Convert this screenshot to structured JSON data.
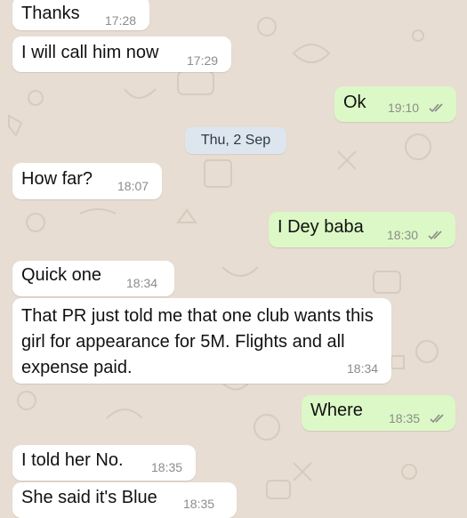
{
  "conversation": {
    "date_separator": "Thu, 2 Sep",
    "messages": [
      {
        "direction": "incoming",
        "text": "Thanks",
        "time": "17:28"
      },
      {
        "direction": "incoming",
        "text": "I will call him now",
        "time": "17:29"
      },
      {
        "direction": "outgoing",
        "text": "Ok",
        "time": "19:10",
        "status": "read"
      },
      {
        "direction": "incoming",
        "text": "How far?",
        "time": "18:07"
      },
      {
        "direction": "outgoing",
        "text": "I Dey baba",
        "time": "18:30",
        "status": "read"
      },
      {
        "direction": "incoming",
        "text": "Quick one",
        "time": "18:34"
      },
      {
        "direction": "incoming",
        "text": "That PR just told me that one club wants this girl for appearance for 5M. Flights and all expense paid.",
        "time": "18:34"
      },
      {
        "direction": "outgoing",
        "text": "Where",
        "time": "18:35",
        "status": "read"
      },
      {
        "direction": "incoming",
        "text": "I told her No.",
        "time": "18:35"
      },
      {
        "direction": "incoming",
        "text": "She said it's Blue",
        "time": "18:35"
      }
    ]
  },
  "colors": {
    "background": "#e7ddd2",
    "incoming_bubble": "#ffffff",
    "outgoing_bubble": "#dcf8c6",
    "timestamp": "#8c8c8c",
    "read_ticks": "#8c8c8c",
    "date_pill": "#dde6ef"
  },
  "icons": {
    "read_receipt": "double-check-icon",
    "wallpaper": "chat-doodle-pattern"
  }
}
